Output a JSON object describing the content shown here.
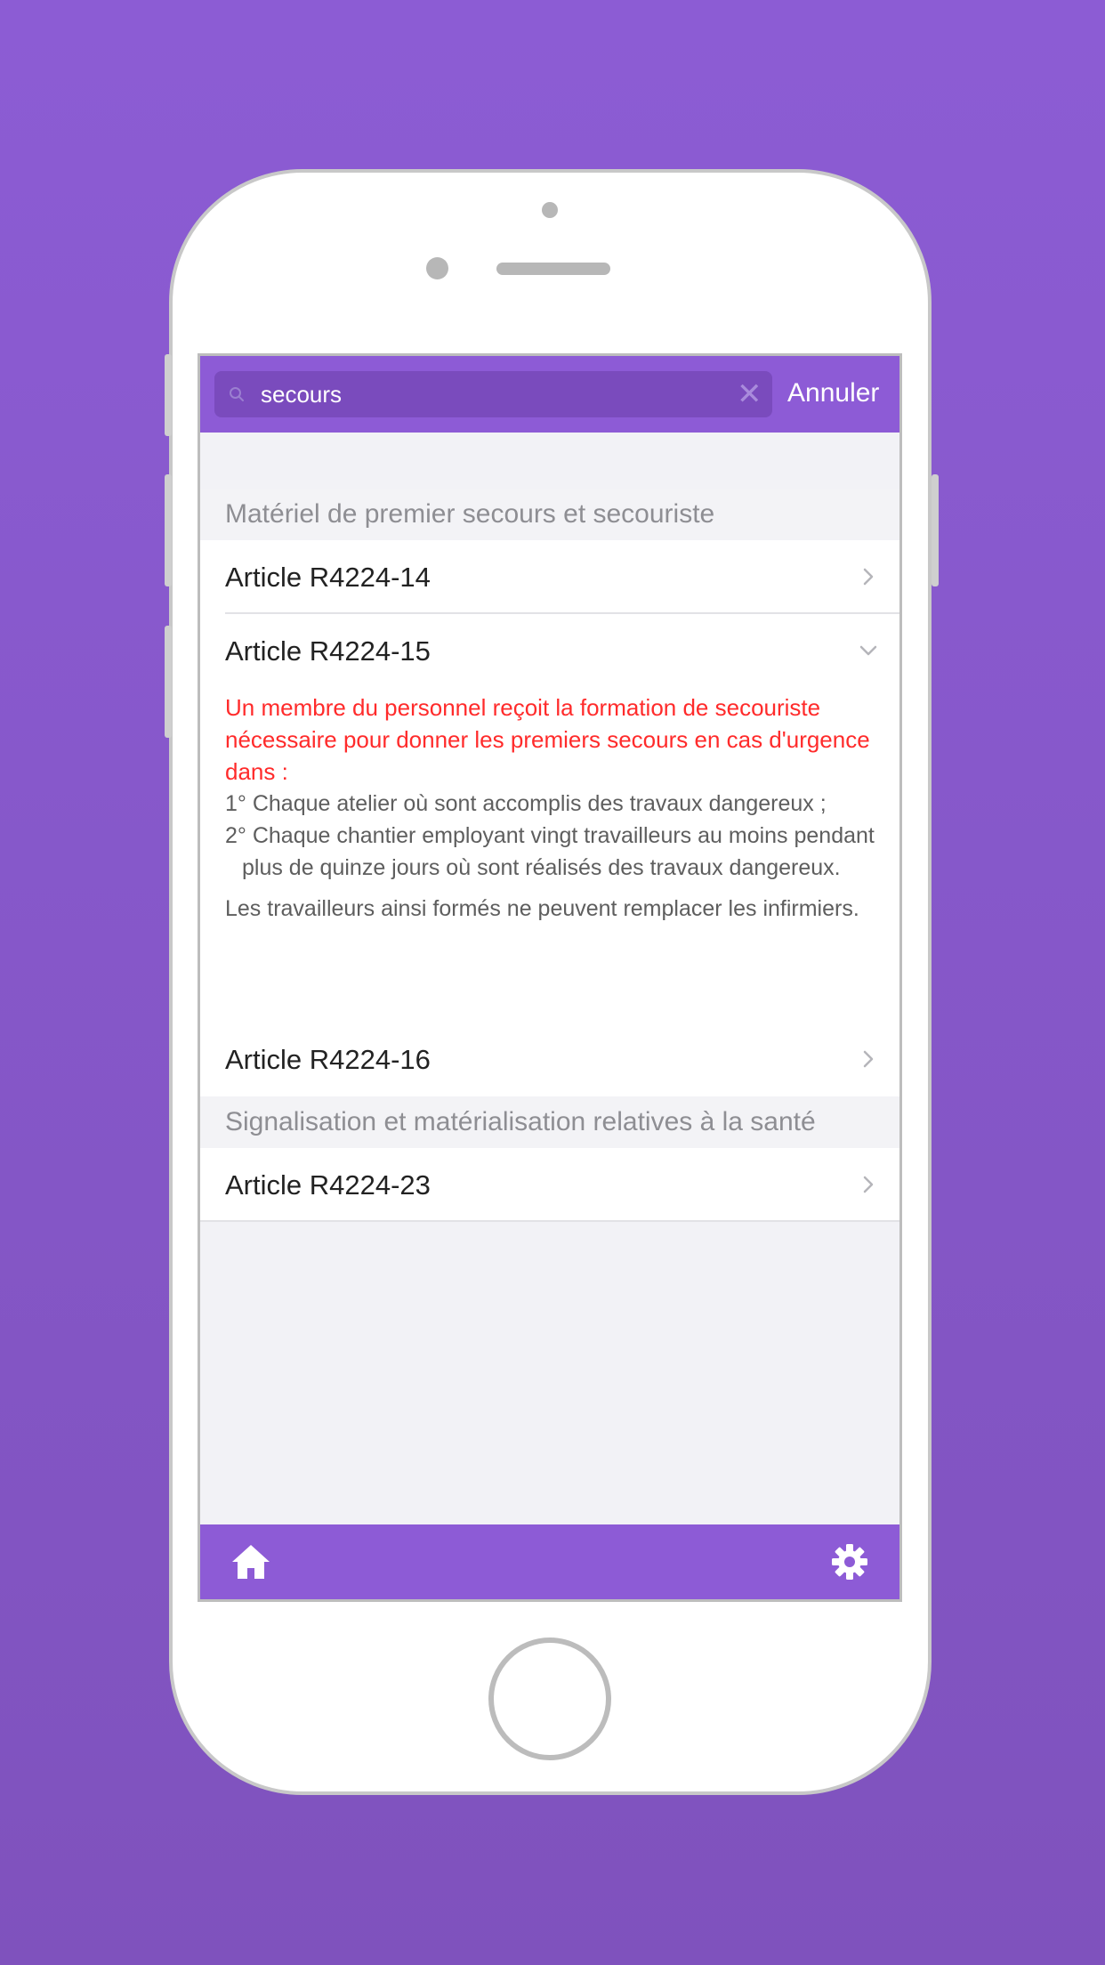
{
  "search": {
    "query": "secours",
    "cancel_label": "Annuler"
  },
  "sections": [
    {
      "title": "Matériel de premier secours et secouriste",
      "articles": [
        {
          "label": "Article R4224-14",
          "expanded": false
        },
        {
          "label": "Article R4224-15",
          "expanded": true
        },
        {
          "label": "Article R4224-16",
          "expanded": false
        }
      ]
    },
    {
      "title": "Signalisation et matérialisation relatives à la santé",
      "articles": [
        {
          "label": "Article R4224-23",
          "expanded": false
        }
      ]
    }
  ],
  "expanded_article": {
    "highlight": "Un membre du personnel reçoit la formation de secouriste nécessaire pour donner les premiers secours en cas d'urgence dans :",
    "item_1": "1° Chaque atelier où sont accomplis des travaux dangereux ;",
    "item_2": "2° Chaque chantier employant vingt travailleurs au moins pendant plus de quinze jours où sont réalisés des travaux dangereux.",
    "closing": "Les travailleurs ainsi formés ne peuvent remplacer les infirmiers."
  },
  "colors": {
    "brand_purple": "#8d5bd6",
    "search_field": "#7a4bbd",
    "highlight_red": "#ff2b2b",
    "background": "#8c5cd4"
  },
  "icons": {
    "search": "search-icon",
    "clear": "close-icon",
    "row_closed": "chevron-right-icon",
    "row_open": "chevron-down-icon",
    "tab_home": "home-icon",
    "tab_settings": "gear-icon"
  }
}
